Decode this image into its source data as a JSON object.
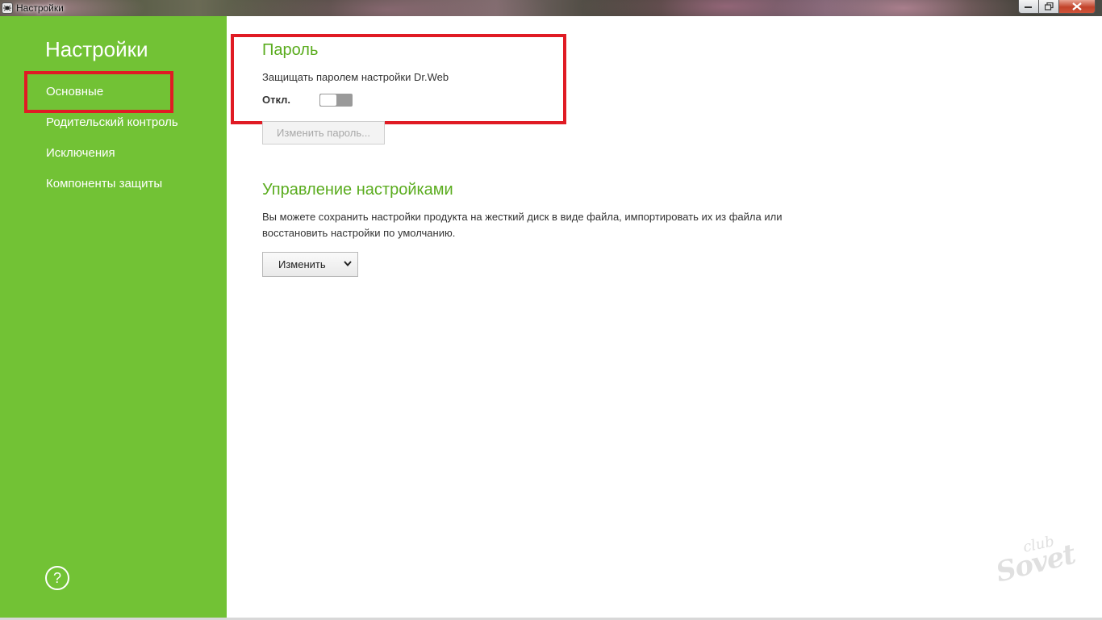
{
  "window": {
    "title": "Настройки",
    "controls": {
      "minimize_icon": "minimize-icon",
      "maximize_icon": "maximize-icon",
      "close_icon": "close-icon"
    }
  },
  "sidebar": {
    "title": "Настройки",
    "items": [
      {
        "label": "Основные",
        "selected": true
      },
      {
        "label": "Родительский контроль"
      },
      {
        "label": "Исключения"
      },
      {
        "label": "Компоненты защиты"
      }
    ],
    "help_symbol": "?",
    "bg_color": "#72c235"
  },
  "password": {
    "title": "Пароль",
    "description": "Защищать паролем настройки Dr.Web",
    "toggle_label": "Откл.",
    "toggle_state": "off",
    "change_password_button": "Изменить пароль..."
  },
  "settings_management": {
    "title": "Управление настройками",
    "description_line1": "Вы можете сохранить настройки продукта на жесткий диск в виде файла, импортировать их из файла или",
    "description_line2": "восстановить настройки по умолчанию.",
    "change_button": "Изменить"
  },
  "watermark": {
    "line1": "club",
    "line2": "Sovet"
  },
  "colors": {
    "accent_green": "#5aac1e",
    "highlight_red": "#e01b24"
  }
}
